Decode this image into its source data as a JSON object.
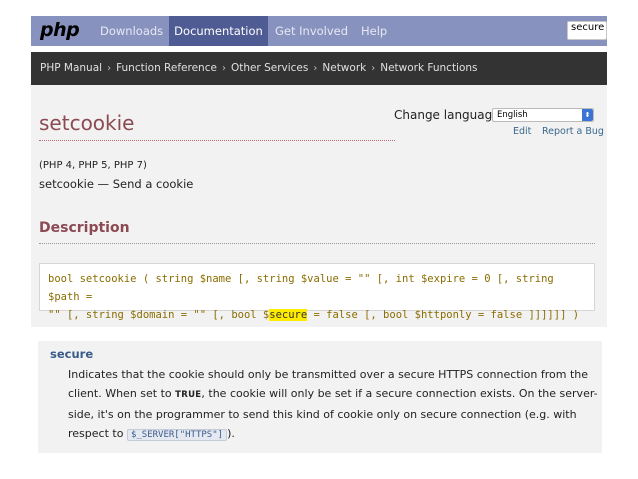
{
  "nav": {
    "logo": "php",
    "items": [
      "Downloads",
      "Documentation",
      "Get Involved",
      "Help"
    ],
    "search_value": "secure"
  },
  "breadcrumb": [
    "PHP Manual",
    "Function Reference",
    "Other Services",
    "Network",
    "Network Functions"
  ],
  "breadcrumb_separator": "›",
  "page": {
    "title": "setcookie",
    "change_language_label": "Change language:",
    "language_selected": "English",
    "edit_link": "Edit",
    "report_link": "Report a Bug",
    "versions": "(PHP 4, PHP 5, PHP 7)",
    "refname": "setcookie — Send a cookie",
    "description_heading": "Description"
  },
  "signature": {
    "line1": {
      "t1": "bool setcookie ( ",
      "t2": "string $name [, string $value = \"\" [, int $expire = 0 [, string $path ="
    },
    "line2_pre": "\"\" [, string $domain = \"\" [, bool $",
    "line2_hl": "secure",
    "line2_post": " = false [, bool $httponly = false ]]]]]] )"
  },
  "parameter": {
    "name": "secure",
    "desc_part1": "Indicates that the cookie should only be transmitted over a secure HTTPS connection from the client. When set to ",
    "desc_const": "TRUE",
    "desc_part2": ", the cookie will only be set if a secure connection exists. On the server-side, it's on the programmer to send this kind of cookie only on secure connection (e.g. with respect to ",
    "desc_code": "$_SERVER[\"HTTPS\"]",
    "desc_part3": ")."
  },
  "colors": {
    "nav_bg": "#8892bf",
    "nav_active": "#4f5b93",
    "breadcrumb_bg": "#333333",
    "title": "#8b4a52",
    "highlight": "#ffeb00"
  }
}
